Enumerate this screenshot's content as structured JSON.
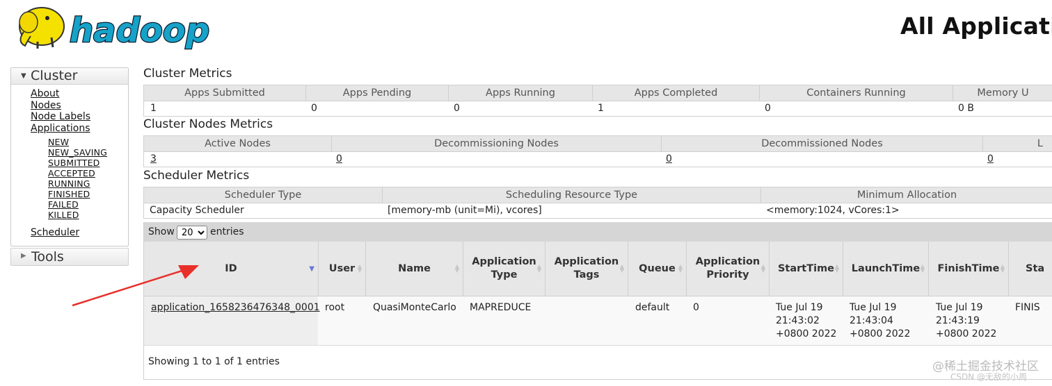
{
  "header": {
    "brand": "hadoop",
    "page_title": "All Applicati"
  },
  "nav": {
    "cluster_label": "Cluster",
    "cluster_links": [
      "About",
      "Nodes",
      "Node Labels",
      "Applications"
    ],
    "app_states": [
      "NEW",
      "NEW_SAVING",
      "SUBMITTED",
      "ACCEPTED",
      "RUNNING",
      "FINISHED",
      "FAILED",
      "KILLED"
    ],
    "scheduler_label": "Scheduler",
    "tools_label": "Tools"
  },
  "cluster_metrics": {
    "title": "Cluster Metrics",
    "headers": [
      "Apps Submitted",
      "Apps Pending",
      "Apps Running",
      "Apps Completed",
      "Containers Running",
      "Memory U"
    ],
    "values": [
      "1",
      "0",
      "0",
      "1",
      "0",
      "0 B"
    ]
  },
  "nodes_metrics": {
    "title": "Cluster Nodes Metrics",
    "headers": [
      "Active Nodes",
      "Decommissioning Nodes",
      "Decommissioned Nodes",
      "L"
    ],
    "values": [
      "3",
      "0",
      "0",
      "0"
    ]
  },
  "scheduler_metrics": {
    "title": "Scheduler Metrics",
    "headers": [
      "Scheduler Type",
      "Scheduling Resource Type",
      "Minimum Allocation"
    ],
    "values": [
      "Capacity Scheduler",
      "[memory-mb (unit=Mi), vcores]",
      "<memory:1024, vCores:1>"
    ]
  },
  "apps_table": {
    "show_label": "Show",
    "entries_label": "entries",
    "page_length": "20",
    "page_length_options": [
      "20"
    ],
    "headers": [
      "ID",
      "User",
      "Name",
      "Application Type",
      "Application Tags",
      "Queue",
      "Application Priority",
      "StartTime",
      "LaunchTime",
      "FinishTime",
      "Sta"
    ],
    "row": {
      "id": "application_1658236476348_0001",
      "user": "root",
      "name": "QuasiMonteCarlo",
      "type": "MAPREDUCE",
      "tags": "",
      "queue": "default",
      "priority": "0",
      "start_time": [
        "Tue Jul 19",
        "21:43:02",
        "+0800 2022"
      ],
      "launch_time": [
        "Tue Jul 19",
        "21:43:04",
        "+0800 2022"
      ],
      "finish_time": [
        "Tue Jul 19",
        "21:43:19",
        "+0800 2022"
      ],
      "state": "FINIS"
    },
    "footer_info": "Showing 1 to 1 of 1 entries"
  },
  "watermark": {
    "line1": "@稀土掘金技术社区",
    "line2": "CSDN @无敌的小周"
  },
  "colors": {
    "arrow": "#e8302a",
    "sort_active": "#6b74d6",
    "logo_yellow": "#f5e100",
    "logo_blue": "#17a2c9"
  }
}
